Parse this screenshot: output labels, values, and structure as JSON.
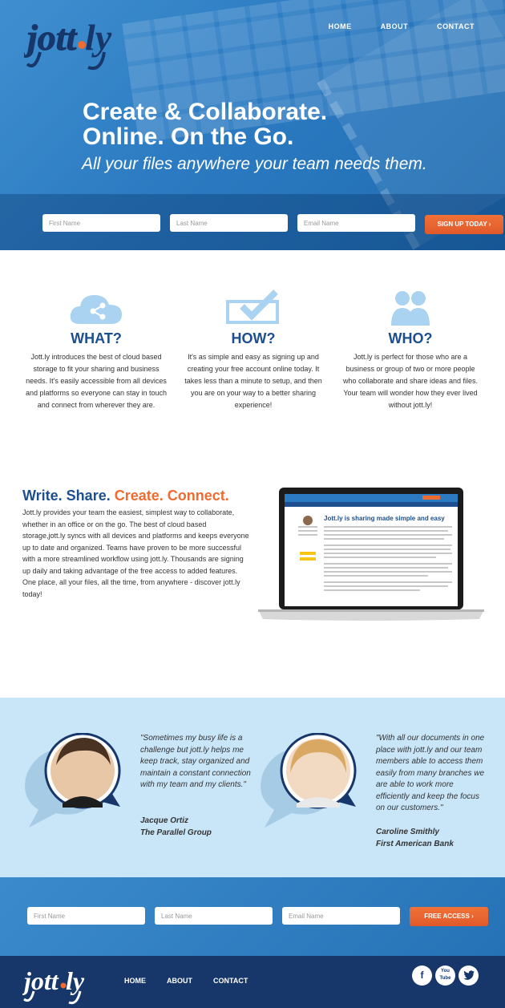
{
  "brand": {
    "logo_text": "jott.ly"
  },
  "nav": {
    "home": "HOME",
    "about": "ABOUT",
    "contact": "CONTACT"
  },
  "hero": {
    "headline_line1": "Create & Collaborate.",
    "headline_line2": "Online. On the Go.",
    "subheadline": "All your files anywhere your team needs them."
  },
  "signup_top": {
    "first_name_placeholder": "First Name",
    "last_name_placeholder": "Last Name",
    "email_placeholder": "Email Name",
    "button_label": "SIGN UP TODAY ›"
  },
  "features": [
    {
      "title": "WHAT?",
      "icon": "cloud-share-icon",
      "text": "Jott.ly introduces the best of cloud based storage to fit your sharing and business needs. It's easily accessible from all devices and platforms so everyone can stay in touch and connect from wherever they are."
    },
    {
      "title": "HOW?",
      "icon": "checkbox-icon",
      "text": "It's as simple and easy as signing up and creating your free account online today. It takes less than a minute to setup, and then you are on your way to a better sharing experience!"
    },
    {
      "title": "WHO?",
      "icon": "people-icon",
      "text": "Jott.ly is perfect for those who are a business or group of two or more people who collaborate and share ideas and files. Your team will wonder how they ever lived without jott.ly!"
    }
  ],
  "write_section": {
    "title_part1": "Write. Share.",
    "title_part2": "Create. Connect.",
    "body": "Jott.ly provides your team the easiest, simplest way to collaborate, whether in an office or on the go. The best of cloud based storage,jott.ly syncs with all devices and platforms and keeps everyone up to date and organized. Teams have proven to be more successful with a more streamlined workflow using jott.ly. Thousands are signing up daily and taking advantage of the free access to added features. One place, all your files, all the time, from anywhere - discover jott.ly today!",
    "screen_heading": "Jott.ly is sharing made simple and easy"
  },
  "testimonials": [
    {
      "quote": "\"Sometimes my busy life is a challenge but jott.ly helps me keep track, stay organized and maintain a constant connection with my team and my clients.\"",
      "name": "Jacque Ortiz",
      "company": "The Parallel Group"
    },
    {
      "quote": "\"With all our documents in one place with jott.ly and our team members able to access them easily from many branches we are able to work more efficiently and keep the focus on our customers.\"",
      "name": "Caroline Smithly",
      "company": "First American Bank"
    }
  ],
  "signup_bottom": {
    "first_name_placeholder": "First Name",
    "last_name_placeholder": "Last Name",
    "email_placeholder": "Email Name",
    "button_label": "FREE ACCESS ›"
  },
  "social": {
    "youtube_label": "You Tube"
  },
  "colors": {
    "brand_blue": "#1d4f8e",
    "accent_orange": "#ef6b2f",
    "light_blue": "#c9e5f8",
    "footer_navy": "#17376a"
  }
}
